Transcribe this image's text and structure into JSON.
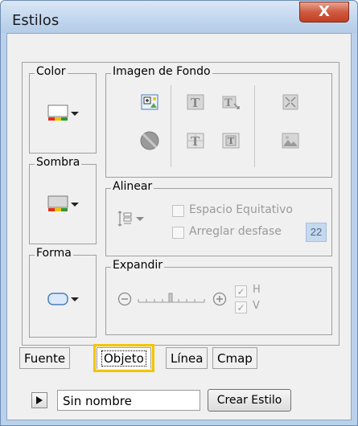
{
  "window": {
    "title": "Estilos",
    "close_label": "X"
  },
  "groups": {
    "color": "Color",
    "sombra": "Sombra",
    "forma": "Forma",
    "imagen": "Imagen de Fondo",
    "alinear": "Alinear",
    "expandir": "Expandir"
  },
  "alinear": {
    "espacio_label": "Espacio Equitativo",
    "arreglar_label": "Arreglar desfase",
    "desfase_value": "22"
  },
  "expandir": {
    "h_label": "H",
    "v_label": "V"
  },
  "tabs": [
    {
      "label": "Fuente"
    },
    {
      "label": "Objeto",
      "selected": true
    },
    {
      "label": "Línea"
    },
    {
      "label": "Cmap"
    }
  ],
  "bottom": {
    "name_value": "Sin nombre",
    "create_label": "Crear Estilo"
  }
}
